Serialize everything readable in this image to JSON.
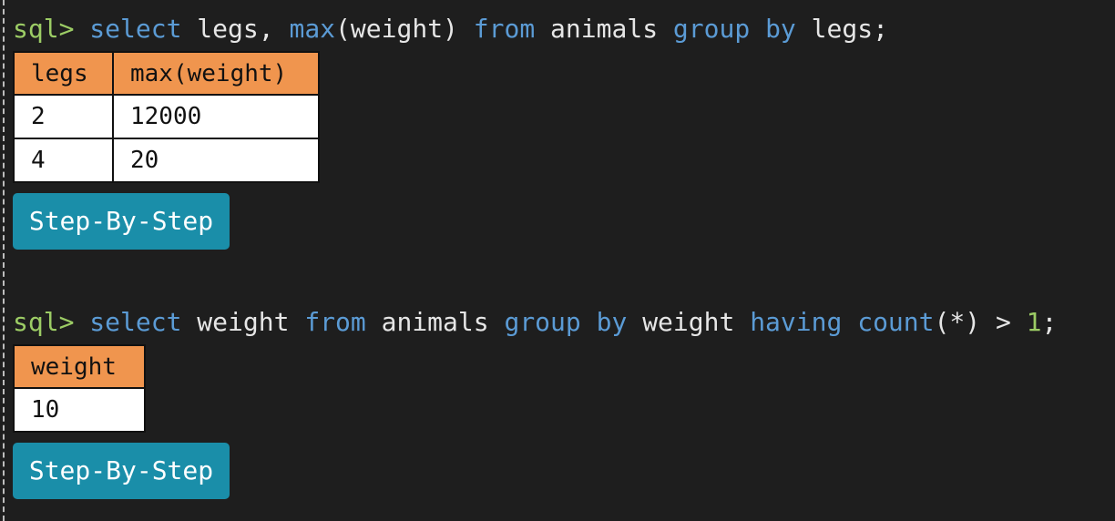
{
  "query1": {
    "prompt": "sql>",
    "tokens": [
      {
        "text": " "
      },
      {
        "text": "select",
        "cls": "kw"
      },
      {
        "text": " legs, "
      },
      {
        "text": "max",
        "cls": "kw"
      },
      {
        "text": "(weight) "
      },
      {
        "text": "from",
        "cls": "kw"
      },
      {
        "text": " animals "
      },
      {
        "text": "group",
        "cls": "kw"
      },
      {
        "text": " "
      },
      {
        "text": "by",
        "cls": "kw"
      },
      {
        "text": " legs;"
      }
    ],
    "columns": [
      "legs",
      "max(weight)"
    ],
    "rows": [
      [
        "2",
        "12000"
      ],
      [
        "4",
        "20"
      ]
    ],
    "button_label": "Step-By-Step"
  },
  "query2": {
    "prompt": "sql>",
    "tokens": [
      {
        "text": " "
      },
      {
        "text": "select",
        "cls": "kw"
      },
      {
        "text": " weight "
      },
      {
        "text": "from",
        "cls": "kw"
      },
      {
        "text": " animals "
      },
      {
        "text": "group",
        "cls": "kw"
      },
      {
        "text": " "
      },
      {
        "text": "by",
        "cls": "kw"
      },
      {
        "text": " weight "
      },
      {
        "text": "having",
        "cls": "kw"
      },
      {
        "text": " "
      },
      {
        "text": "count",
        "cls": "kw"
      },
      {
        "text": "(*) > "
      },
      {
        "text": "1",
        "cls": "num"
      },
      {
        "text": ";"
      }
    ],
    "columns": [
      "weight"
    ],
    "rows": [
      [
        "10"
      ]
    ],
    "button_label": "Step-By-Step"
  },
  "colors": {
    "background": "#1e1e1e",
    "prompt": "#9ccc65",
    "keyword": "#5b9bd5",
    "header": "#f0954e",
    "button": "#1a8ea9"
  }
}
